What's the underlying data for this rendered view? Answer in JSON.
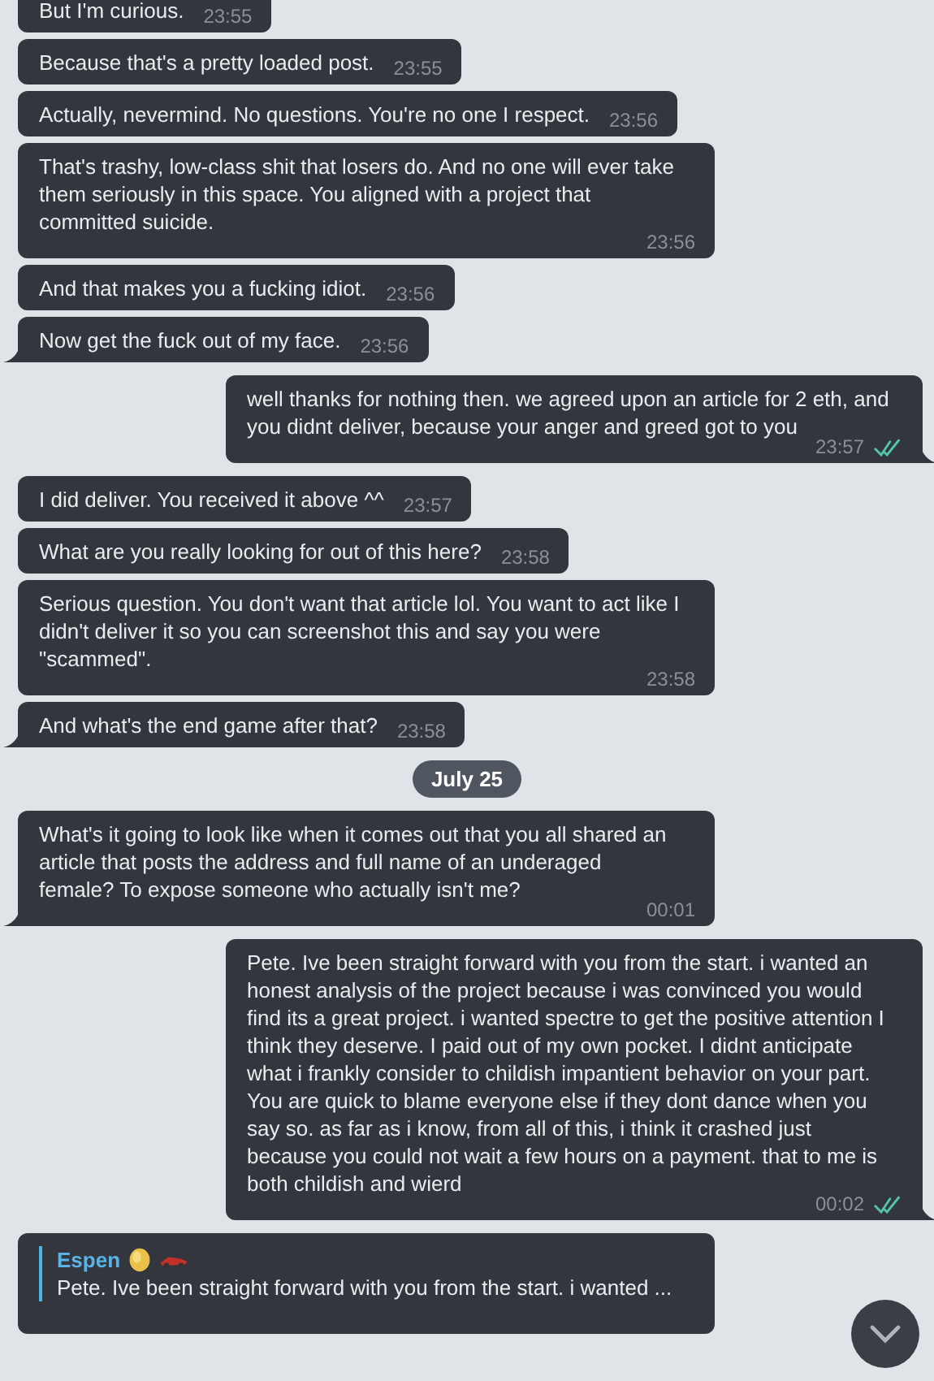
{
  "messages": [
    {
      "kind": "in",
      "text": "But I'm curious.",
      "time": "23:55",
      "tail": false
    },
    {
      "kind": "in",
      "text": "Because that's a pretty loaded post.",
      "time": "23:55",
      "tail": false
    },
    {
      "kind": "in",
      "text": "Actually, nevermind. No questions. You're no one I respect.",
      "time": "23:56",
      "tail": false
    },
    {
      "kind": "in",
      "text": "That's trashy, low-class shit that losers do. And no one will ever take them seriously in this space. You aligned with a project that committed suicide.",
      "time": "23:56",
      "tail": false
    },
    {
      "kind": "in",
      "text": "And that makes you a fucking idiot.",
      "time": "23:56",
      "tail": false
    },
    {
      "kind": "in",
      "text": "Now get the fuck out of my face.",
      "time": "23:56",
      "tail": true
    },
    {
      "kind": "out",
      "text": "well thanks for nothing then. we agreed upon an article for 2 eth, and you didnt deliver, because your anger and greed got to you",
      "time": "23:57",
      "tail": true,
      "read": true
    },
    {
      "kind": "in",
      "text": "I did deliver. You received it above ^^",
      "time": "23:57",
      "tail": false
    },
    {
      "kind": "in",
      "text": "What are you really looking for out of this here?",
      "time": "23:58",
      "tail": false
    },
    {
      "kind": "in",
      "text": "Serious question. You don't want that article lol. You want to act like I didn't deliver it so you can screenshot this and say you were \"scammed\".",
      "time": "23:58",
      "tail": false
    },
    {
      "kind": "in",
      "text": "And what's the end game after that?",
      "time": "23:58",
      "tail": true
    },
    {
      "kind": "date",
      "text": "July 25"
    },
    {
      "kind": "in",
      "text": "What's it going to look like when it comes out that you all shared an article that posts the address and full name of an underaged female? To expose someone who actually isn't me?",
      "time": "00:01",
      "tail": true
    },
    {
      "kind": "out",
      "text": "Pete. Ive been straight forward with you from the start. i wanted an honest analysis of the project because i was convinced you would find its a great project. i wanted spectre to get the positive attention I think they deserve. I paid out of my own pocket. I didnt anticipate what i frankly consider to childish impantient behavior on your part. You are quick to blame everyone else if they dont dance when you say so. as far as i know, from all of this, i think it crashed just because you could not wait a few hours on a payment. that to me is both childish and wierd",
      "time": "00:02",
      "tail": true,
      "read": true
    },
    {
      "kind": "reply",
      "name": "Espen",
      "quote": "Pete. Ive been straight forward with you from the start. i wanted ..."
    }
  ]
}
